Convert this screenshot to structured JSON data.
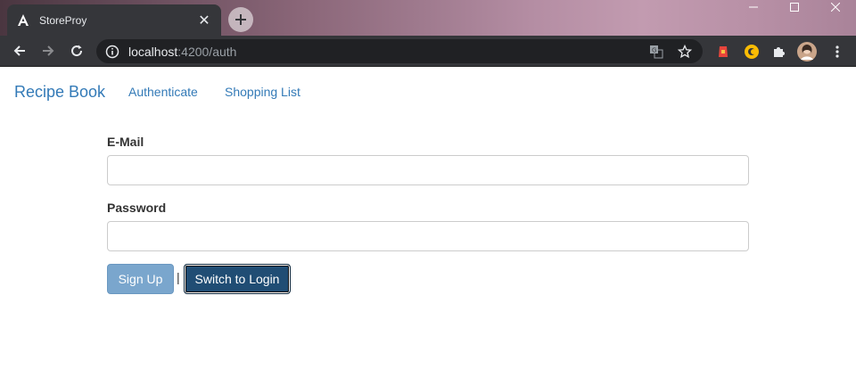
{
  "browser": {
    "tab_title": "StoreProy",
    "url_host": "localhost",
    "url_rest": ":4200/auth",
    "tab_icon": "angular-icon"
  },
  "navbar": {
    "brand": "Recipe Book",
    "links": [
      "Authenticate",
      "Shopping List"
    ]
  },
  "form": {
    "email_label": "E-Mail",
    "email_value": "",
    "password_label": "Password",
    "password_value": "",
    "submit_label": "Sign Up",
    "separator": "|",
    "switch_label": "Switch to Login"
  },
  "colors": {
    "link": "#337ab7",
    "primary_disabled": "#7aa6cd",
    "primary_active": "#204d74"
  }
}
